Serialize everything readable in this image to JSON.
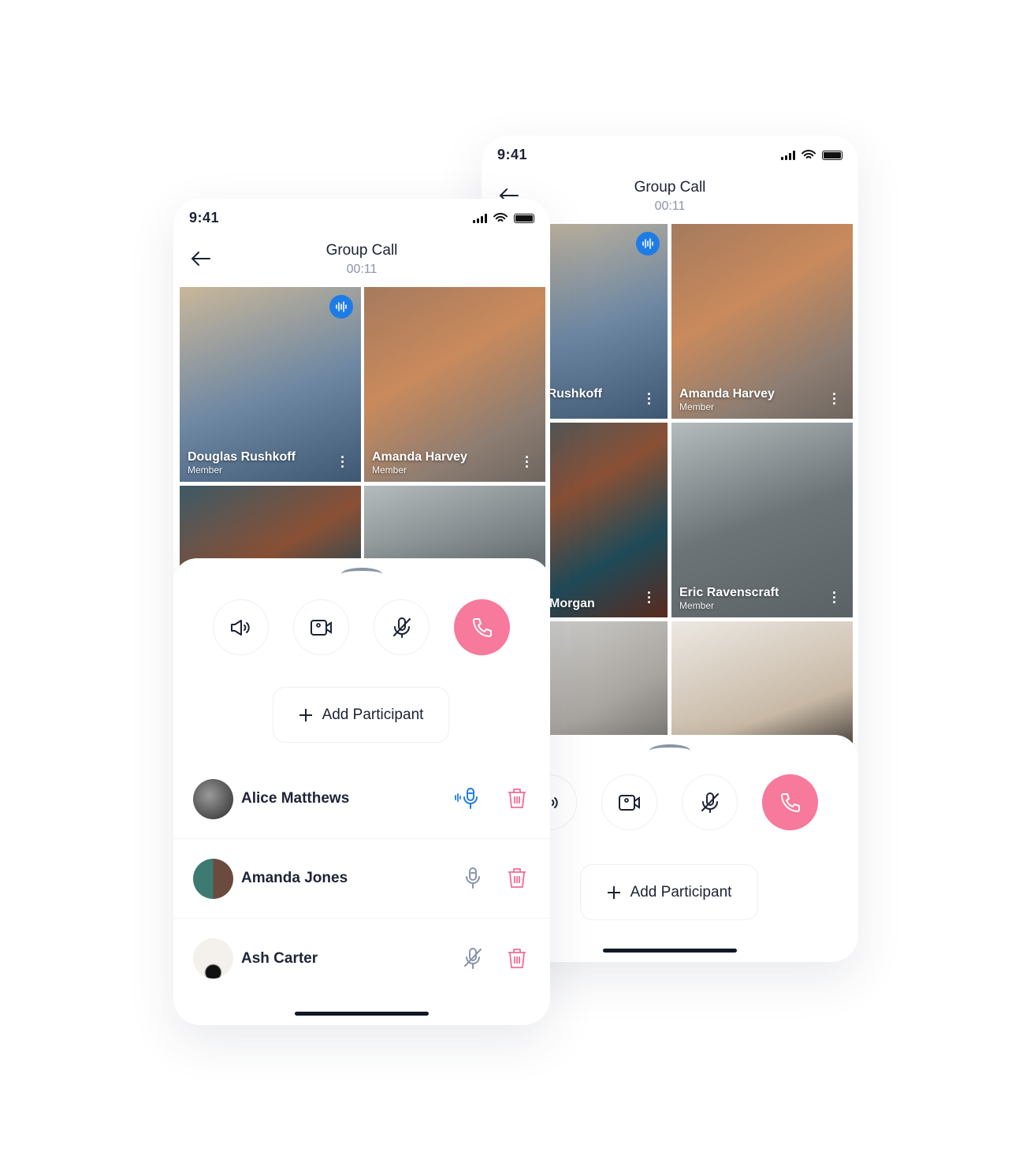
{
  "status_bar": {
    "time": "9:41"
  },
  "header": {
    "title": "Group Call",
    "timer": "00:11"
  },
  "participants_grid": [
    {
      "name": "Douglas Rushkoff",
      "role": "Member",
      "speaking": true
    },
    {
      "name": "Amanda Harvey",
      "role": "Member"
    },
    {
      "name": "Morgan",
      "role": ""
    },
    {
      "name": "Eric Ravenscraft",
      "role": "Member"
    },
    {
      "name": "",
      "role": ""
    },
    {
      "name": "",
      "role": ""
    }
  ],
  "controls": {
    "speaker": "speaker-icon",
    "video": "video-icon",
    "mic": "mic-off-icon",
    "end_call": "phone-icon",
    "end_call_color": "#f7799b"
  },
  "add_participant_label": "Add Participant",
  "participant_list": [
    {
      "name": "Alice Matthews",
      "mic": "speaking",
      "mic_color": "#1e7ce6"
    },
    {
      "name": "Amanda Jones",
      "mic": "on",
      "mic_color": "#8a95a8"
    },
    {
      "name": "Ash Carter",
      "mic": "muted",
      "mic_color": "#8a95a8"
    }
  ],
  "colors": {
    "accent": "#1e7ce6",
    "danger": "#f06d94"
  }
}
